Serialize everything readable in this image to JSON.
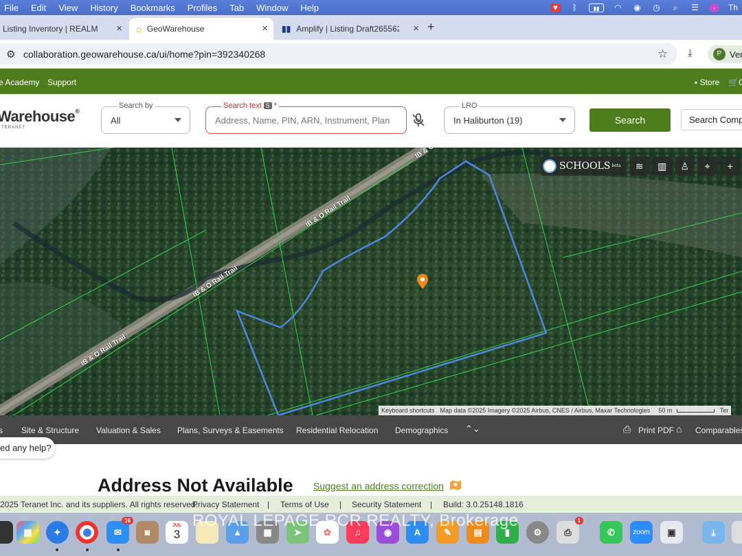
{
  "menubar": {
    "items": [
      "File",
      "Edit",
      "View",
      "History",
      "Bookmarks",
      "Profiles",
      "Tab",
      "Window",
      "Help"
    ],
    "tray_tail": "Th"
  },
  "tabs": [
    {
      "title": "Listing Inventory | REALM",
      "active": false
    },
    {
      "title": "GeoWarehouse",
      "active": true
    },
    {
      "title": "Amplify | Listing Draft265562",
      "active": false
    }
  ],
  "address_bar": {
    "url": "collaboration.geowarehouse.ca/ui/home?pin=392340268",
    "profile_label": "Ver"
  },
  "greenbar": {
    "left_link": "e Academy",
    "support": "Support",
    "store": "Store",
    "cart": "C"
  },
  "header": {
    "logo_text": "Warehouse",
    "logo_sub": "TERANET",
    "search_by": {
      "label": "Search by",
      "value": "All"
    },
    "search_text": {
      "label": "Search text",
      "chip": "S",
      "required": "*",
      "placeholder": "Address, Name, PIN, ARN, Instrument, Plan"
    },
    "lro": {
      "label": "LRO",
      "value": "In Haliburton (19)"
    },
    "search_button": "Search",
    "comparables_button": "Search Compa"
  },
  "map": {
    "rail_labels": [
      "IB & O Rail Trail",
      "IB & O Rail Trail",
      "IB & O Rail Trail",
      "IB & O"
    ],
    "schools_label": "SCHOOLS",
    "schools_beta": "beta",
    "attribution": {
      "shortcuts": "Keyboard shortcuts",
      "data": "Map data ©2025 Imagery ©2025 Airbus, CNES / Airbus, Maxar Technologies",
      "scale": "50 m",
      "terms": "Ter"
    }
  },
  "report_tabs": {
    "items": [
      "s",
      "Site & Structure",
      "Valuation & Sales",
      "Plans, Surveys & Easements",
      "Residential Relocation",
      "Demographics"
    ],
    "print": "Print PDF",
    "comparables": "Comparables"
  },
  "pane": {
    "help": "ed any help?",
    "title": "Address Not Available",
    "suggest": "Suggest an address correction"
  },
  "footer": {
    "copyright": "2025 Teranet Inc. and its suppliers. All rights reserved.",
    "privacy": "Privacy Statement",
    "terms": "Terms of Use",
    "security": "Security Statement",
    "build": "Build: 3.0.25148.1816",
    "sep": "|"
  },
  "dock": {
    "calendar_month": "JUL",
    "calendar_day": "3",
    "mail_badge": "16",
    "notif_badge": "1",
    "zoom": "zoom"
  },
  "watermark": "ROYAL LEPAGE RCR REALTY, Brokerage",
  "colors": {
    "menubar": "#4a6dc9",
    "brand_green": "#4f7d1d",
    "report_bar": "#474747",
    "parcel_outline": "#4f86e0",
    "lot_lines": "#35d04a"
  }
}
